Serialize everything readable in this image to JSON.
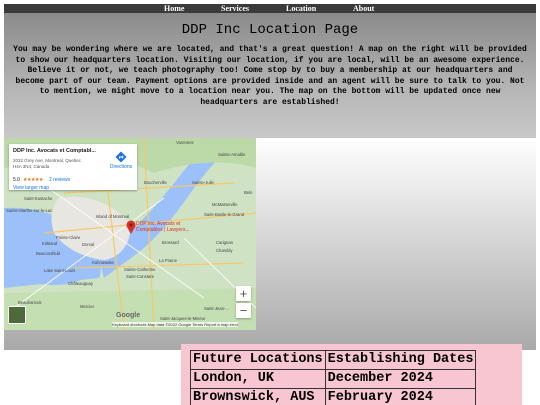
{
  "nav": {
    "items": [
      {
        "label": "Home"
      },
      {
        "label": "Services"
      },
      {
        "label": "Location"
      },
      {
        "label": "About"
      }
    ]
  },
  "header": {
    "title": "DDP Inc Location Page",
    "intro": "You may be wondering where we are located, and that's a great question! A map on the right will be provided to show our headquarters location. Visiting our location, if you are local, will be an awesome experience. Believe it or not, we teach photography too! Come stop by to buy a membership at our headquarters and become part of our team. Payment options are provided inside and an agent will be sure to talk to you. Not to mention, we might move to a location near you. The map on the bottom will be updated once new headquarters are established!"
  },
  "map": {
    "card": {
      "name": "DDP Inc. Avocats et Comptabl...",
      "address_line1": "2032 Grey Ave, Montreal, Quebec",
      "address_line2": "H4A 3N4, Canada",
      "rating": "5.0",
      "stars": "★★★★★",
      "reviews": "2 reviews",
      "larger_map": "View larger map",
      "directions": "Directions"
    },
    "pin_label_line1": "DDP Inc. Avocats et",
    "pin_label_line2": "Comptables | Lawyers...",
    "labels": {
      "varennes": "Varennes",
      "sainte_amable": "Sainte-Amable",
      "boucherville": "Boucherville",
      "sainte_julie": "Sainte-Julie",
      "saint_eustache": "Saint-Eustache",
      "sainte_marthe": "Sainte-Marthe-sur-le-Lac",
      "island_of_montreal": "Island of Montreal",
      "dorval": "Dorval",
      "pointe_claire": "Pointe-Claire",
      "kirkland": "Kirkland",
      "beaconsfield": "Beaconsfield",
      "brossard": "Brossard",
      "la_prairie": "La Prairie",
      "kahnawake": "Kahnawake",
      "sainte_catherine": "Sainte-Catherine",
      "saint_constant": "Saint-Constant",
      "chateauguay": "Châteauguay",
      "lake_saint_louis": "Lake Saint-Louis",
      "carignan": "Carignan",
      "chambly": "Chambly",
      "mcmasterville": "McMasterville",
      "saint_basile": "Saint-Basile-le-Grand",
      "beauharnois": "Beauharnois",
      "mercier": "Mercier",
      "saint_jean": "Saint-Jean-...",
      "saint_jacques": "Saint-Jacques-le-Mineur",
      "belo": "Belo"
    },
    "google_logo": "Google",
    "footer": "Keyboard shortcuts   Map data ©2022 Google   Terms   Report a map error",
    "zoom_in": "+",
    "zoom_out": "−"
  },
  "locations_table": {
    "headers": [
      "Future Locations",
      "Establishing Dates"
    ],
    "rows": [
      [
        "London, UK",
        "December 2024"
      ],
      [
        "Brownswick, AUS",
        "February 2024"
      ]
    ]
  }
}
